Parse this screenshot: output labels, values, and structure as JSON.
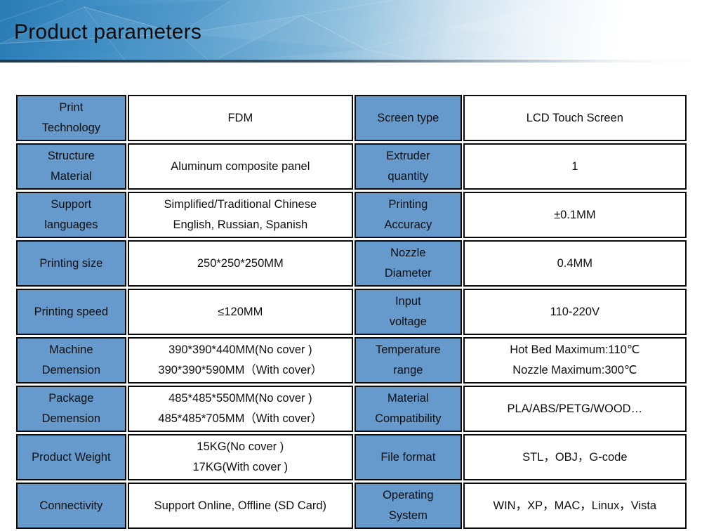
{
  "header": {
    "title": "Product parameters",
    "accent_color": "#2a7cb5",
    "label_cell_color": "#6699cc",
    "border_color": "#0a0a0a"
  },
  "table": {
    "rows": [
      {
        "label_left": [
          "Print",
          "Technology"
        ],
        "value_left": [
          "FDM"
        ],
        "label_right": [
          "Screen type"
        ],
        "value_right": [
          "LCD Touch Screen"
        ]
      },
      {
        "label_left": [
          "Structure",
          "Material"
        ],
        "value_left": [
          "Aluminum composite panel"
        ],
        "label_right": [
          "Extruder",
          "quantity"
        ],
        "value_right": [
          "1"
        ]
      },
      {
        "label_left": [
          "Support",
          "languages"
        ],
        "value_left": [
          "Simplified/Traditional Chinese",
          "English, Russian, Spanish"
        ],
        "label_right": [
          "Printing",
          "Accuracy"
        ],
        "value_right": [
          "±0.1MM"
        ]
      },
      {
        "label_left": [
          "Printing size"
        ],
        "value_left": [
          "250*250*250MM"
        ],
        "label_right": [
          "Nozzle",
          "Diameter"
        ],
        "value_right": [
          "0.4MM"
        ]
      },
      {
        "label_left": [
          "Printing speed"
        ],
        "value_left": [
          "≤120MM"
        ],
        "label_right": [
          "Input",
          "voltage"
        ],
        "value_right": [
          "110-220V"
        ]
      },
      {
        "label_left": [
          "Machine",
          "Demension"
        ],
        "value_left": [
          "390*390*440MM(No cover )",
          "390*390*590MM（With cover）"
        ],
        "label_right": [
          "Temperature",
          "range"
        ],
        "value_right": [
          "Hot Bed Maximum:110℃",
          "Nozzle Maximum:300℃"
        ]
      },
      {
        "label_left": [
          "Package",
          "Demension"
        ],
        "value_left": [
          "485*485*550MM(No cover )",
          "485*485*705MM（With cover）"
        ],
        "label_right": [
          "Material",
          "Compatibility"
        ],
        "value_right": [
          "PLA/ABS/PETG/WOOD…"
        ]
      },
      {
        "label_left": [
          "Product Weight"
        ],
        "value_left": [
          "15KG(No cover )",
          "17KG(With cover )"
        ],
        "label_right": [
          "File format"
        ],
        "value_right": [
          "STL，OBJ，G-code"
        ]
      },
      {
        "label_left": [
          "Connectivity"
        ],
        "value_left": [
          "Support Online, Offline (SD Card)"
        ],
        "label_right": [
          "Operating",
          "System"
        ],
        "value_right": [
          "WIN，XP，MAC，Linux，Vista"
        ]
      }
    ]
  }
}
